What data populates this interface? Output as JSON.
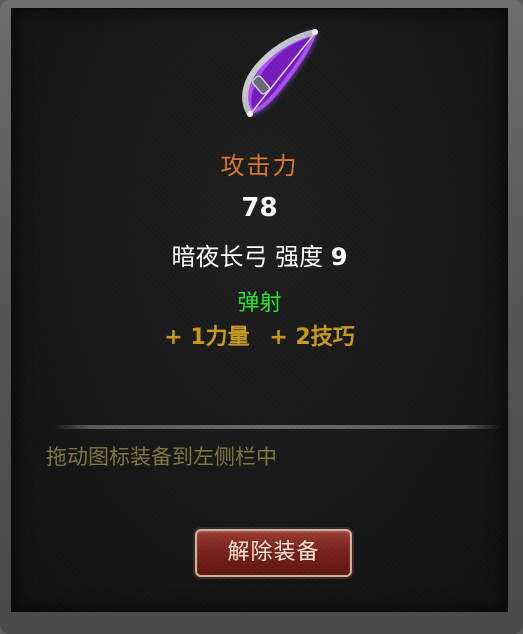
{
  "tooltip": {
    "stat_name": "攻击力",
    "stat_value": "78",
    "item_name": "暗夜长弓",
    "strength_label": "强度",
    "strength_value": "9",
    "effect": "弹射",
    "bonuses": [
      "+ 1力量",
      "+ 2技巧"
    ],
    "hint": "拖动图标装备到左侧栏中",
    "unequip_label": "解除装备",
    "item_icon": "bow-icon",
    "colors": {
      "stat_name": "#d97a2a",
      "effect": "#27e52b",
      "bonus": "#c99a1d",
      "hint": "#7f7838",
      "icon_glow": "#a43cf0",
      "button": "#7a211c"
    }
  }
}
